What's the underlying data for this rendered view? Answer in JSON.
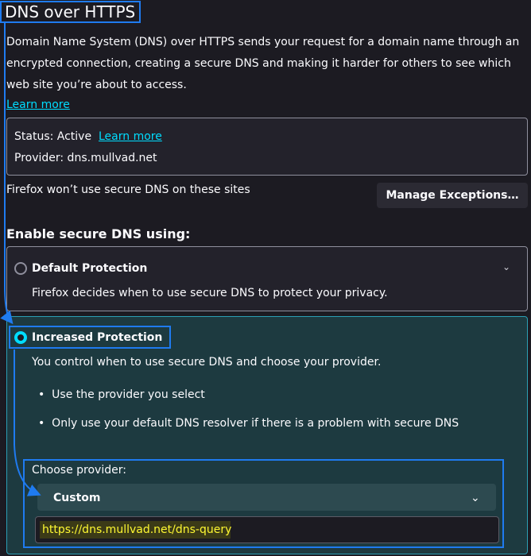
{
  "title": "DNS over HTTPS",
  "description": "Domain Name System (DNS) over HTTPS sends your request for a domain name through an encrypted connection, creating a secure DNS and making it harder for others to see which web site you’re about to access.",
  "learn_more": "Learn more",
  "status": {
    "status_label": "Status: Active",
    "learn_more": "Learn more",
    "provider_label": "Provider: dns.mullvad.net"
  },
  "exceptions": {
    "text": "Firefox won’t use secure DNS on these sites",
    "button_label": "Manage Exceptions…"
  },
  "enable_heading": "Enable secure DNS using:",
  "options": {
    "default": {
      "label": "Default Protection",
      "description": "Firefox decides when to use secure DNS to protect your privacy."
    },
    "increased": {
      "label": "Increased Protection",
      "description": "You control when to use secure DNS and choose your provider.",
      "bullets": [
        "Use the provider you select",
        "Only use your default DNS resolver if there is a problem with secure DNS"
      ]
    }
  },
  "provider": {
    "choose_label": "Choose provider:",
    "selected": "Custom",
    "custom_url": "https://dns.mullvad.net/dns-query"
  },
  "colors": {
    "background": "#1c1b22",
    "accent": "#00ddff",
    "annotation": "#1f7bf0",
    "highlight_text": "#fef832"
  }
}
